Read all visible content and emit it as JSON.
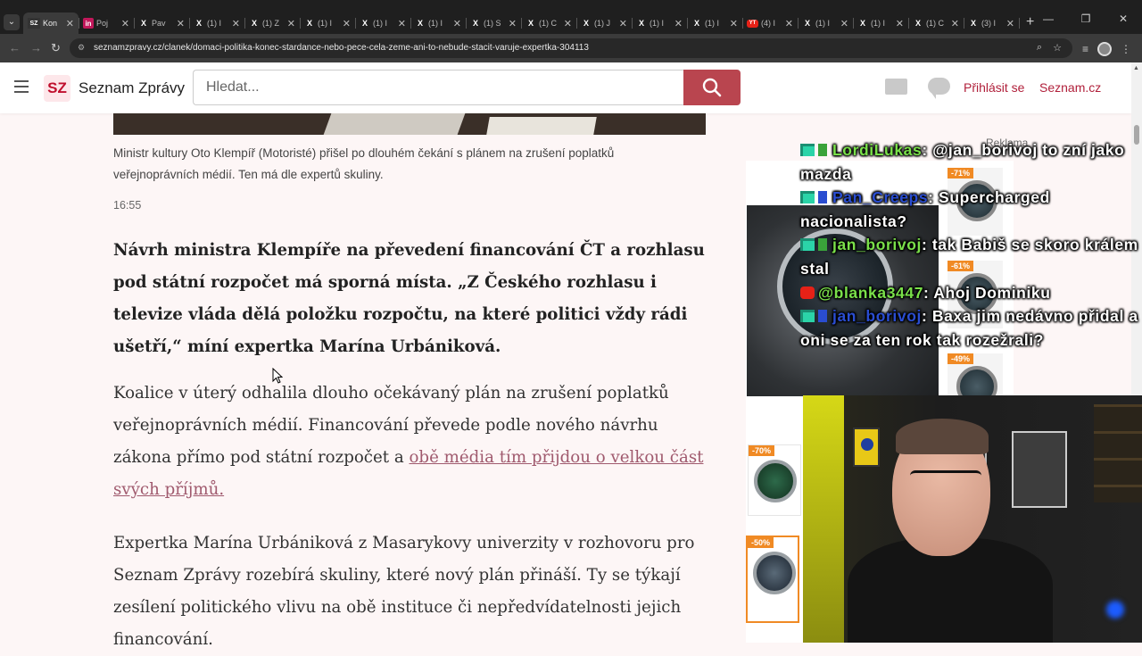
{
  "browser": {
    "tabs": [
      {
        "favicon": "SZ",
        "title": "Kon",
        "active": true
      },
      {
        "favicon": "in",
        "title": "Poj",
        "active": false
      },
      {
        "favicon": "X",
        "title": "Pav",
        "active": false
      },
      {
        "favicon": "X",
        "title": "(1) I",
        "active": false
      },
      {
        "favicon": "X",
        "title": "(1) Z",
        "active": false
      },
      {
        "favicon": "X",
        "title": "(1) I",
        "active": false
      },
      {
        "favicon": "X",
        "title": "(1) I",
        "active": false
      },
      {
        "favicon": "X",
        "title": "(1) I",
        "active": false
      },
      {
        "favicon": "X",
        "title": "(1) S",
        "active": false
      },
      {
        "favicon": "X",
        "title": "(1) C",
        "active": false
      },
      {
        "favicon": "X",
        "title": "(1) J",
        "active": false
      },
      {
        "favicon": "X",
        "title": "(1) I",
        "active": false
      },
      {
        "favicon": "X",
        "title": "(1) I",
        "active": false
      },
      {
        "favicon": "YT",
        "title": "(4) I",
        "active": false
      },
      {
        "favicon": "X",
        "title": "(1) I",
        "active": false
      },
      {
        "favicon": "X",
        "title": "(1) I",
        "active": false
      },
      {
        "favicon": "X",
        "title": "(1) C",
        "active": false
      },
      {
        "favicon": "X",
        "title": "(3) I",
        "active": false
      }
    ],
    "new_tab_label": "+",
    "url": "seznamzpravy.cz/clanek/domaci-politika-konec-stardance-nebo-pece-cela-zeme-ani-to-nebude-stacit-varuje-expertka-304113"
  },
  "header": {
    "logo_badge": "SZ",
    "logo_text": "Seznam Zprávy",
    "search_placeholder": "Hledat...",
    "login": "Přihlásit se",
    "seznam": "Seznam.cz"
  },
  "article": {
    "caption": "Ministr kultury Oto Klempíř (Motoristé) přišel po dlouhém čekání s plánem na zrušení poplatků veřejnoprávních médií. Ten má dle expertů skuliny.",
    "time": "16:55",
    "lead": "Návrh ministra Klempíře na převedení financování ČT a rozhlasu pod státní rozpočet má sporná místa. „Z Českého rozhlasu i televize vláda dělá položku rozpočtu, na které politici vždy rádi ušetří,“ míní expertka Marína Urbániková.",
    "p1_text": "Koalice v úterý odhalila dlouho očekávaný plán na zrušení poplatků veřejnoprávních médií. Financování převede podle nového návrhu zákona přímo pod státní rozpočet a ",
    "p1_link": "obě média tím přijdou o velkou část svých příjmů.",
    "p2": "Expertka Marína Urbániková z Masarykovy univerzity v rozhovoru pro Seznam Zprávy rozebírá skuliny, které nový plán přináší. Ty se týkají zesílení politického vlivu na obě instituce či nepředvídatelnosti jejich financování."
  },
  "ads": {
    "label": "Reklama",
    "badges": [
      "-71%",
      "-61%",
      "-49%",
      "-70%",
      "-50%"
    ],
    "accent": "#f08a24"
  },
  "chat": [
    {
      "user": "LordiLukas",
      "text": ": @jan_borivoj to zní jako mazda",
      "user_color": "#7ae04a",
      "platform": "twitch"
    },
    {
      "user": "Pan_Creeps",
      "text": ": Supercharged nacionalista?",
      "user_color": "#2a4dd1",
      "platform": "twitch"
    },
    {
      "user": "jan_borivoj",
      "text": ": tak Babiš se skoro králem stal",
      "user_color": "#7ae04a",
      "platform": "twitch"
    },
    {
      "user": "@blanka3447",
      "text": ": Ahoj Dominiku",
      "user_color": "#7ae04a",
      "platform": "youtube"
    },
    {
      "user": "jan_borivoj",
      "text": ": Baxa jim nedávno přidal a oni se za ten rok tak rozežrali?",
      "user_color": "#2a4dd1",
      "platform": "twitch"
    }
  ],
  "colors": {
    "brand": "#b01f3a",
    "search_button": "#b9454f",
    "page_bg": "#fdf6f6"
  }
}
